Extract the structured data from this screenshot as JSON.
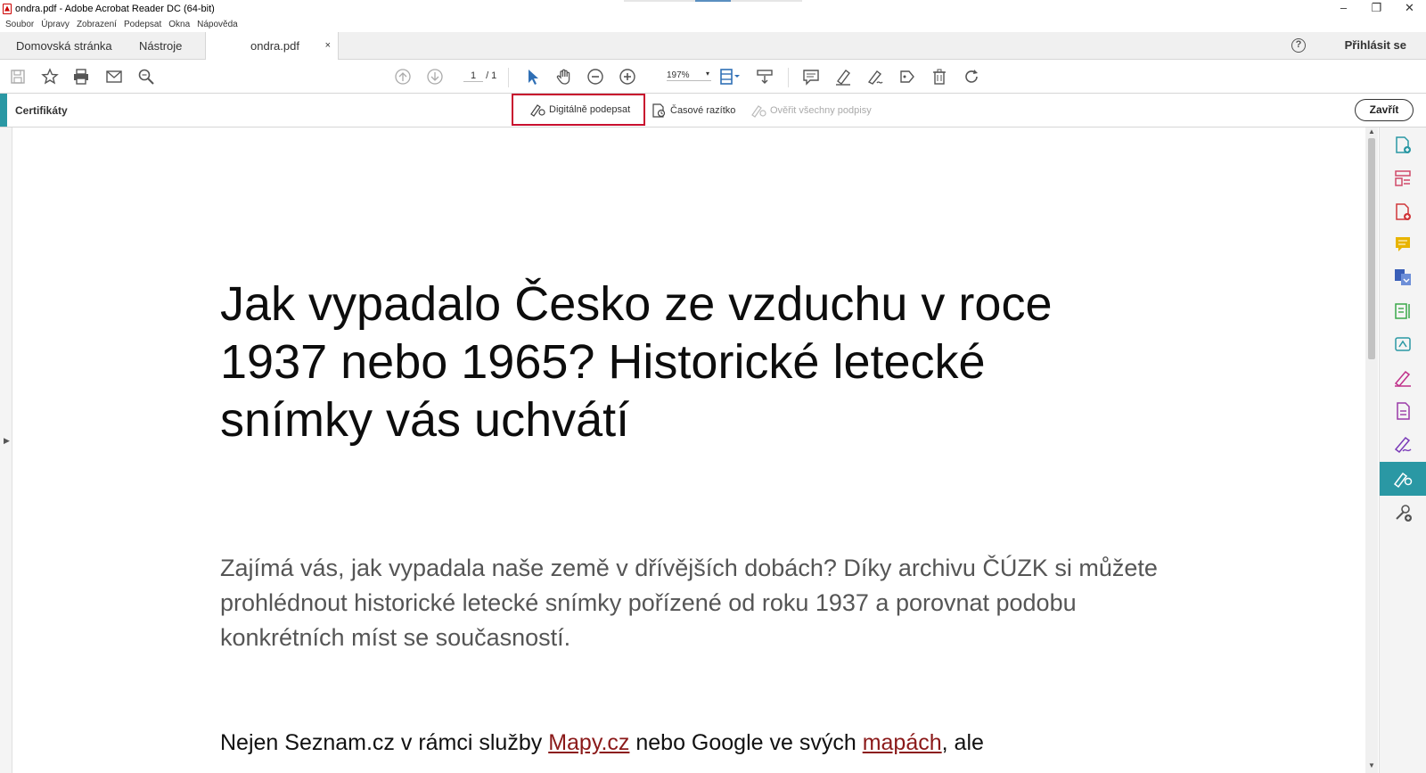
{
  "window": {
    "title": "ondra.pdf - Adobe Acrobat Reader DC (64-bit)",
    "controls": [
      "–",
      "❐",
      "✕"
    ]
  },
  "menu": [
    "Soubor",
    "Úpravy",
    "Zobrazení",
    "Podepsat",
    "Okna",
    "Nápověda"
  ],
  "tabs": {
    "home": "Domovská stránka",
    "tools": "Nástroje",
    "document": "ondra.pdf",
    "close": "×"
  },
  "header": {
    "help": "?",
    "signin": "Přihlásit se"
  },
  "toolbar": {
    "page_current": "1",
    "page_total": "/ 1",
    "zoom": "197%",
    "zoom_arrow": "▾"
  },
  "certbar": {
    "label": "Certifikáty",
    "sign": "Digitálně podepsat",
    "timestamp": "Časové razítko",
    "verify": "Ověřit všechny podpisy",
    "close": "Zavřít"
  },
  "document": {
    "headline": "Jak vypadalo Česko ze vzduchu v roce 1937 nebo 1965? Historické letecké snímky vás uchvátí",
    "lead": "Zajímá vás, jak vypadala naše země v dřívějších dobách? Díky archivu ČÚZK si můžete prohlédnout historické letecké snímky pořízené od roku 1937 a porovnat podobu konkrétních míst se současností.",
    "body_part1": "Nejen Seznam.cz v rámci služby ",
    "body_link1": "Mapy.cz",
    "body_part2": " nebo Google ve svých ",
    "body_link2": "mapách",
    "body_part3": ", ale"
  },
  "scroll": {
    "up": "▲",
    "down": "▼",
    "left_arrow": "▶"
  },
  "colors": {
    "accent": "#2a98a4",
    "highlight": "#c8102e",
    "link": "#8b1a1a"
  },
  "right_panel_icons": [
    "export-pdf-icon",
    "organize-pages-icon",
    "create-pdf-icon",
    "comment-icon",
    "combine-files-icon",
    "edit-pdf-icon",
    "send-for-review-icon",
    "fill-sign-icon",
    "protect-icon",
    "sign-icon",
    "certificates-icon",
    "more-tools-icon"
  ]
}
